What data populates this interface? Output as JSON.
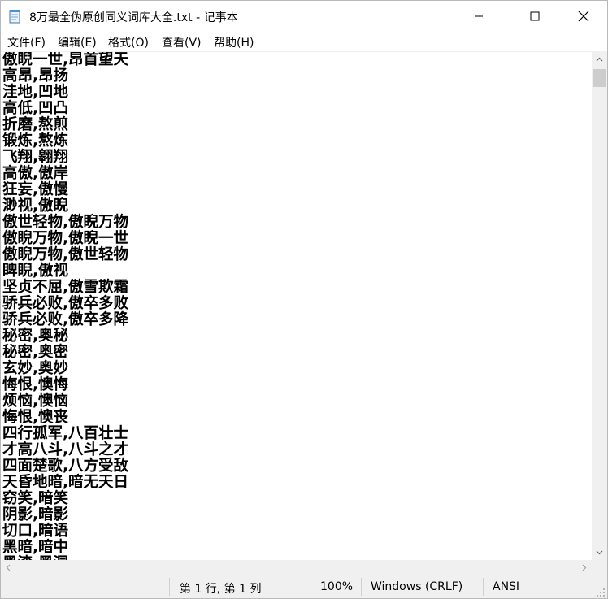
{
  "window": {
    "title": "8万最全伪原创同义词库大全.txt - 记事本"
  },
  "menu": [
    {
      "label": "文件(F)"
    },
    {
      "label": "编辑(E)"
    },
    {
      "label": "格式(O)"
    },
    {
      "label": "查看(V)"
    },
    {
      "label": "帮助(H)"
    }
  ],
  "editor": {
    "lines": [
      "傲睨一世,昂首望天",
      "高昂,昂扬",
      "洼地,凹地",
      "高低,凹凸",
      "折磨,熬煎",
      "锻炼,熬炼",
      "飞翔,翱翔",
      "高傲,傲岸",
      "狂妄,傲慢",
      "渺视,傲睨",
      "傲世轻物,傲睨万物",
      "傲睨万物,傲睨一世",
      "傲睨万物,傲世轻物",
      "睥睨,傲视",
      "坚贞不屈,傲雪欺霜",
      "骄兵必败,傲卒多败",
      "骄兵必败,傲卒多降",
      "秘密,奥秘",
      "秘密,奥密",
      "玄妙,奥妙",
      "悔恨,懊悔",
      "烦恼,懊恼",
      "悔恨,懊丧",
      "四行孤军,八百壮士",
      "才高八斗,八斗之才",
      "四面楚歌,八方受敌",
      "天昏地暗,暗无天日",
      "窃笑,暗笑",
      "阴影,暗影",
      "切口,暗语",
      "黑暗,暗中",
      "黑漆,黑洞"
    ]
  },
  "status": {
    "position": "第 1 行, 第 1 列",
    "zoom": "100%",
    "line_ending": "Windows (CRLF)",
    "encoding": "ANSI"
  },
  "icons": {
    "app": "notepad-icon",
    "minimize": "minimize-icon",
    "maximize": "maximize-icon",
    "close": "close-icon"
  }
}
